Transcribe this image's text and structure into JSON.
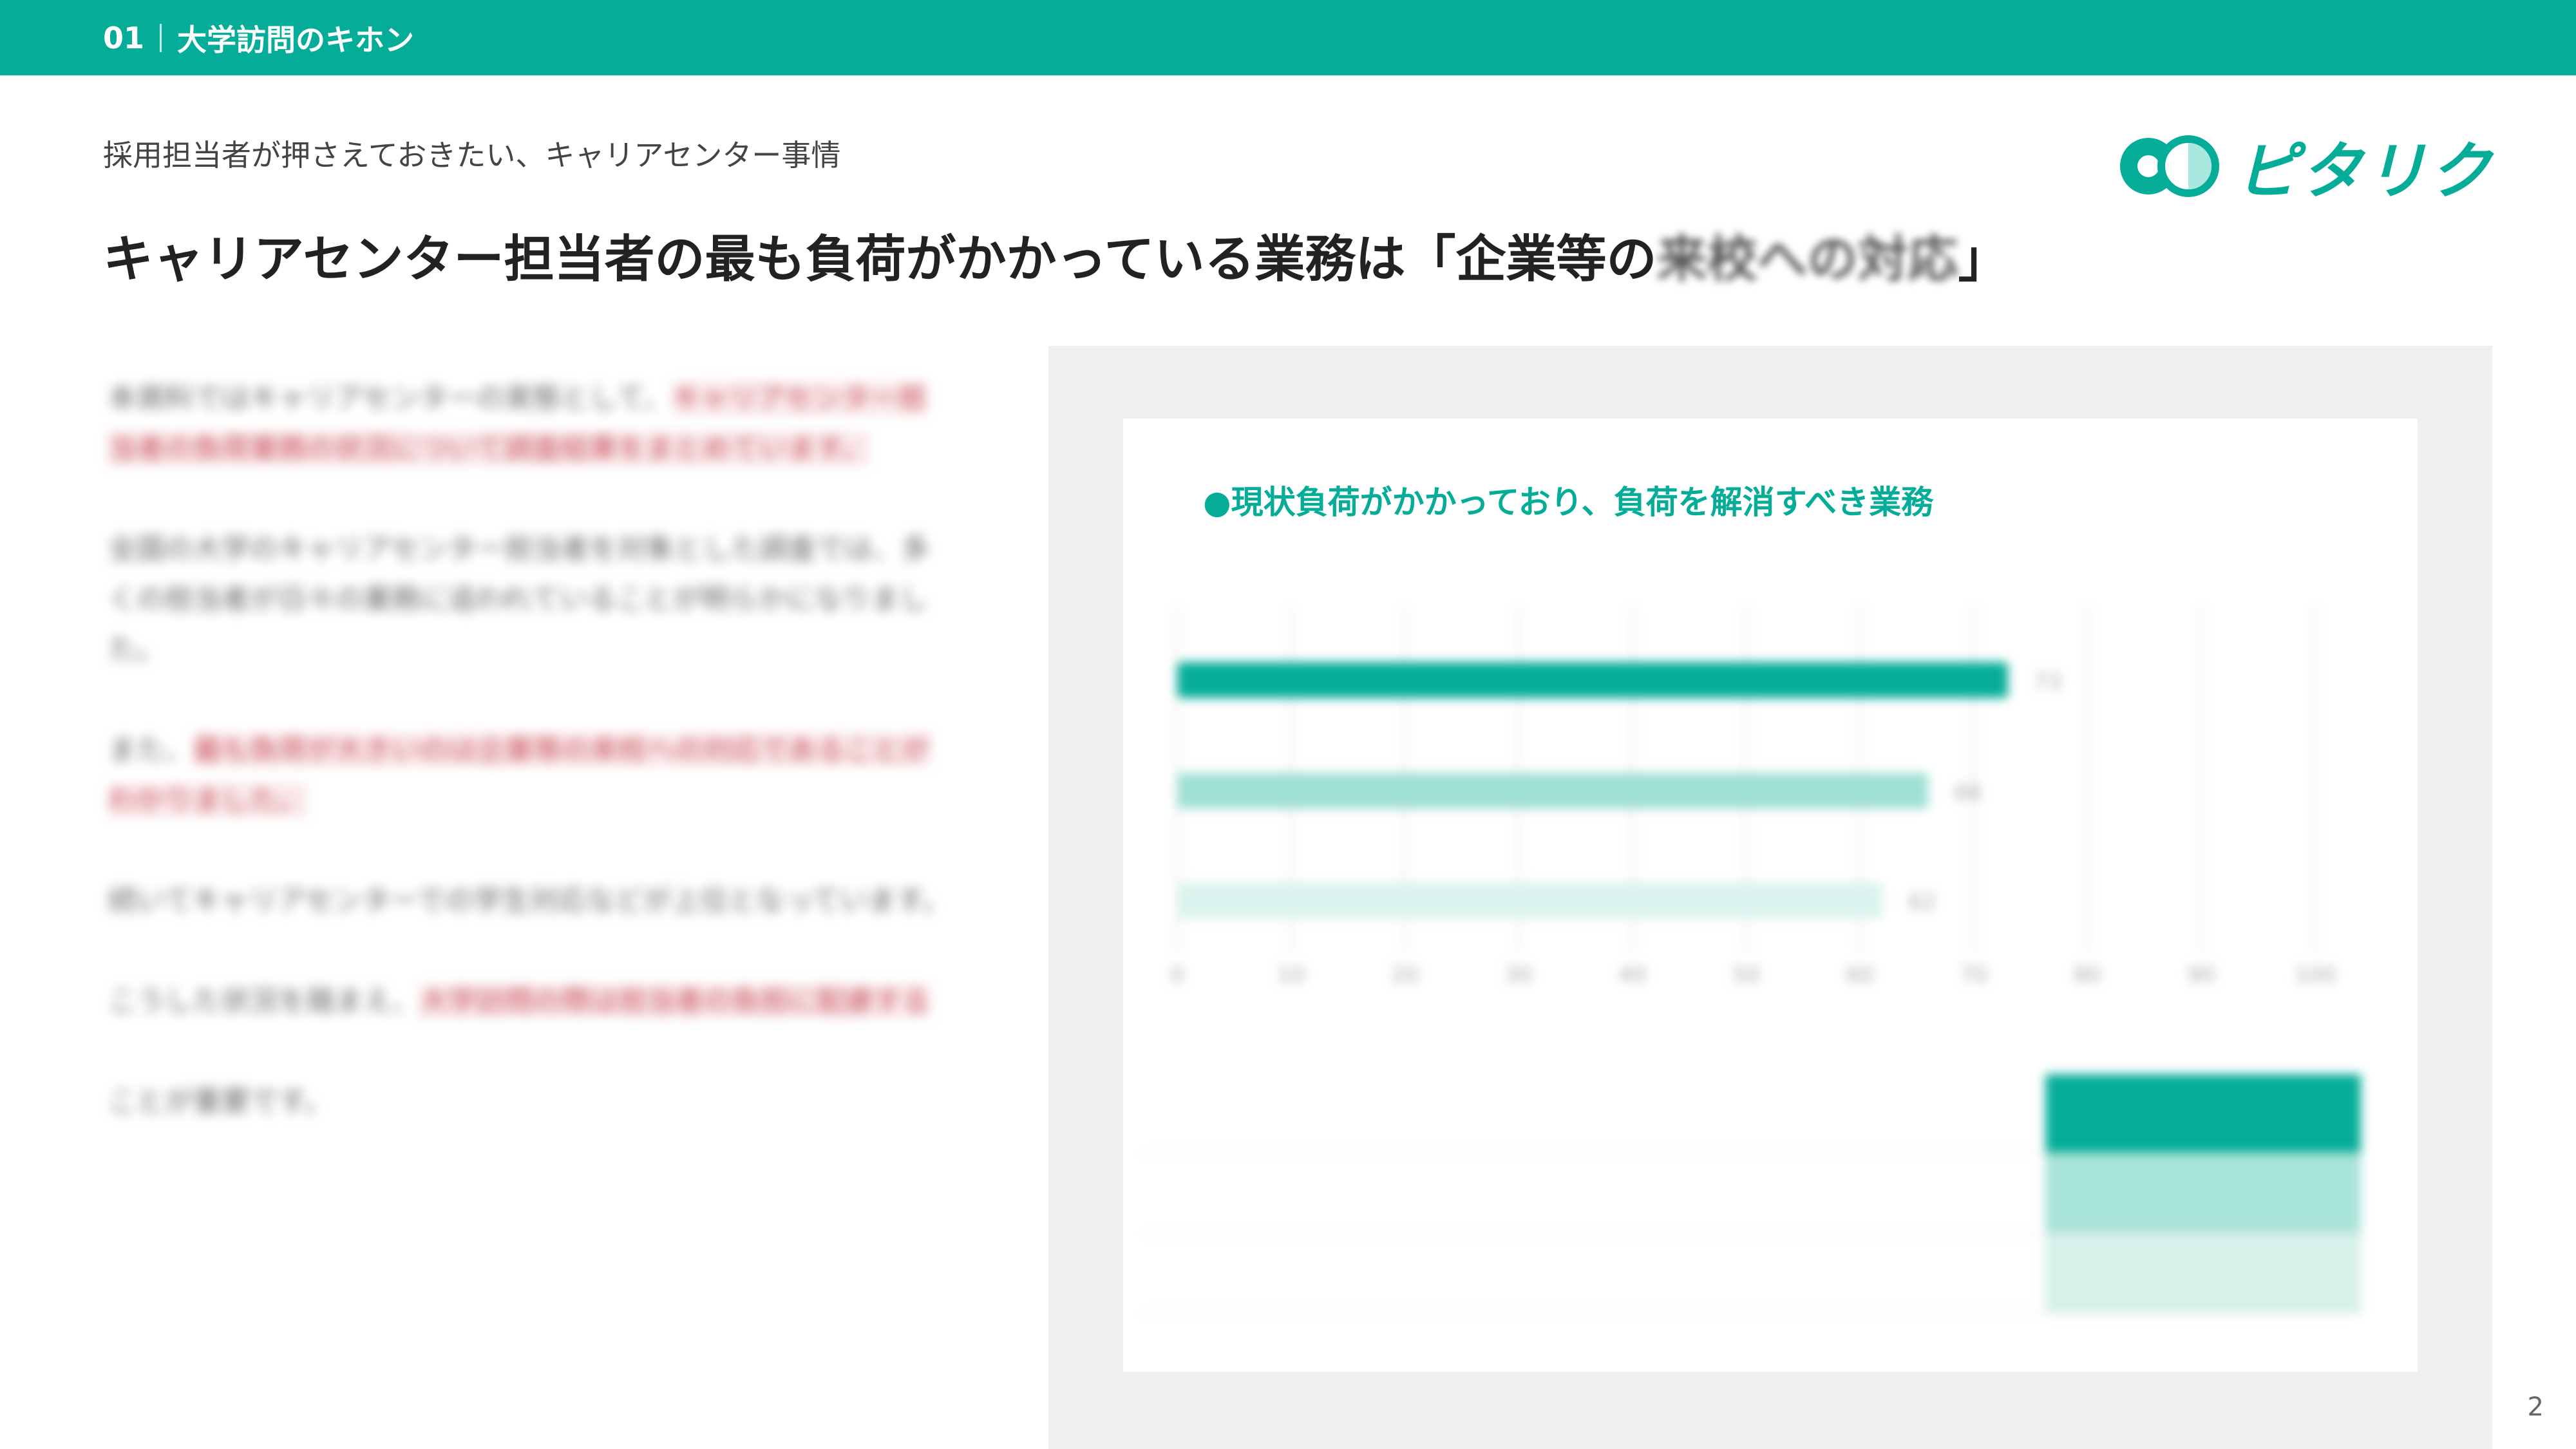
{
  "header": {
    "section_number": "01",
    "section_title": "大学訪問のキホン"
  },
  "subtitle": "採用担当者が押さえておきたい、キャリアセンター事情",
  "headline": {
    "prefix": "キャリアセンター担当者の最も負荷がかかっている業務は「企業等の",
    "blurred": "来校への対応",
    "suffix": "」"
  },
  "logo": {
    "text": "ピタリク",
    "icon": "pitarik-logo-icon"
  },
  "colors": {
    "brand": "#05ad98",
    "bar_primary": "#05ad98",
    "bar_secondary": "#9fe0d4",
    "bar_tertiary": "#dbf3ee",
    "panel_bg": "#efefef"
  },
  "body_paragraphs": [
    {
      "normal": "本資料ではキャリアセンターの実態として、",
      "highlight": "キャリアセンター担当者の負荷業務の状況について調査結果をまとめています。"
    },
    {
      "normal": "全国の大学のキャリアセンター担当者を対象とした調査では、多くの担当者が日々の業務に追われていることが明らかになりました。",
      "highlight": ""
    },
    {
      "normal": "また、",
      "highlight": "最も負荷が大きいのは企業等の来校への対応であることがわかりました。"
    },
    {
      "normal": "続いてキャリアセンターでの学生対応などが上位となっています。",
      "highlight": ""
    },
    {
      "normal": "こうした状況を踏まえ、",
      "highlight": "大学訪問の際は担当者の負担に配慮する"
    },
    {
      "normal": "ことが重要です。",
      "highlight": ""
    }
  ],
  "chart_data": {
    "type": "bar",
    "orientation": "horizontal",
    "title": "●現状負荷がかかっており、負荷を解消すべき業務",
    "categories": [
      "",
      "",
      ""
    ],
    "values": [
      73,
      66,
      62
    ],
    "xlim": [
      0,
      100
    ],
    "xticks": [
      0,
      10,
      20,
      30,
      40,
      50,
      60,
      70,
      80,
      90,
      100
    ],
    "grid": true
  },
  "table": {
    "rows": [
      {
        "label": "",
        "value": ""
      },
      {
        "label": "",
        "value": ""
      },
      {
        "label": "",
        "value": ""
      }
    ]
  },
  "page_number": "2"
}
